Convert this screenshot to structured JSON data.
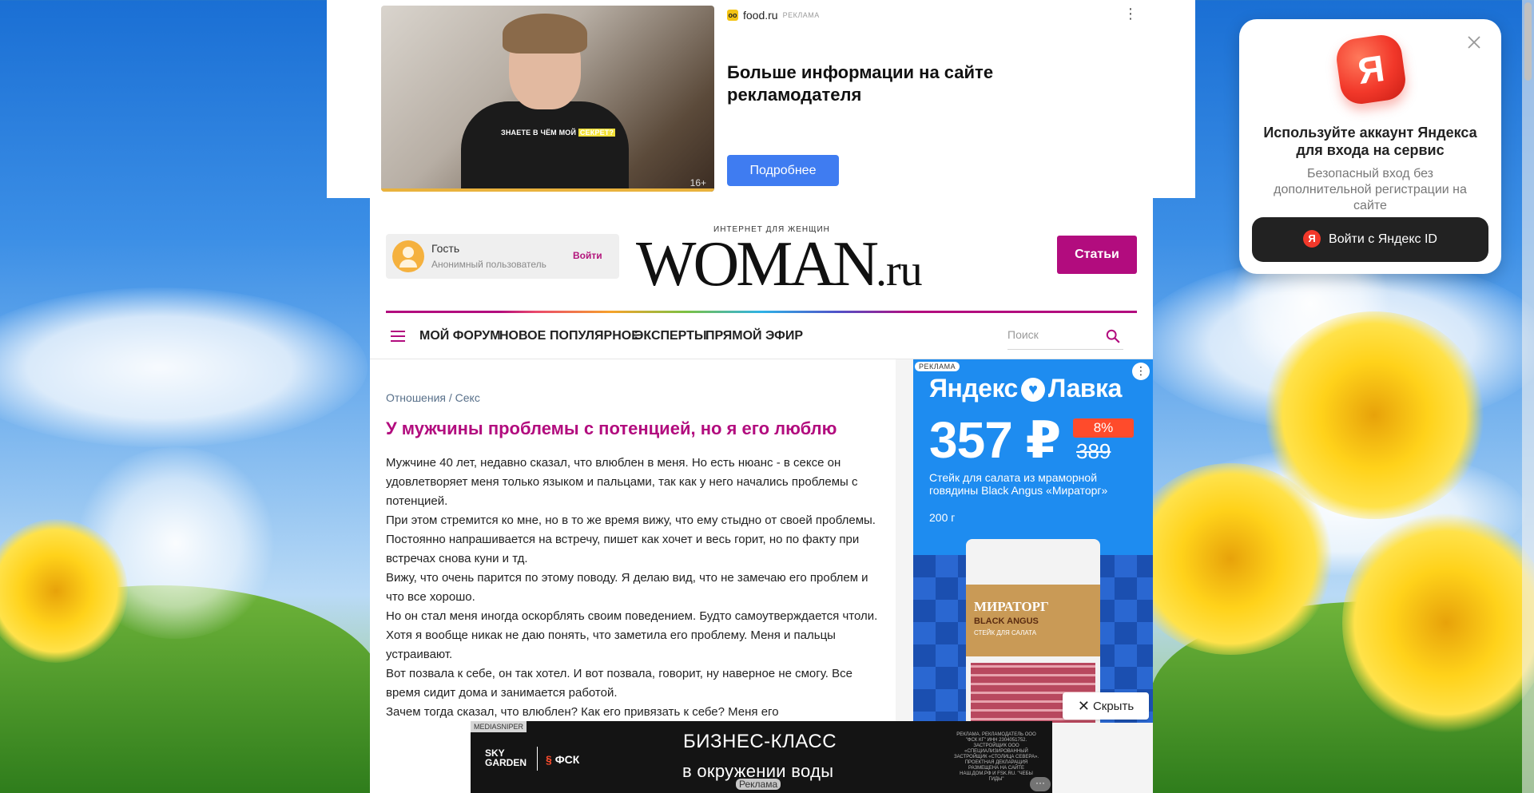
{
  "top_ad": {
    "brand": "food.ru",
    "ad_tag": "РЕКЛАМА",
    "headline": "Больше информации на сайте рекламодателя",
    "cta": "Подробнее",
    "video_subtitle_a": "ЗНАЕТЕ В ЧЁМ МОЙ",
    "video_subtitle_b": "СЕКРЕТ?",
    "age_rating": "16+",
    "menu_icon": "more-vertical-icon"
  },
  "header": {
    "user_name": "Гость",
    "user_sub": "Анонимный пользователь",
    "login": "Войти",
    "logo_tagline": "ИНТЕРНЕТ ДЛЯ ЖЕНЩИН",
    "logo_main": "WOMAN",
    "logo_suffix": ".ru",
    "articles_button": "Статьи",
    "accent_color": "#b20c7e"
  },
  "nav": {
    "items": [
      "МОЙ ФОРУМ",
      "НОВОЕ",
      "ПОПУЛЯРНОЕ",
      "ЭКСПЕРТЫ",
      "ПРЯМОЙ ЭФИР"
    ],
    "search_placeholder": "Поиск"
  },
  "article": {
    "breadcrumb": [
      "Отношения",
      "Секс"
    ],
    "breadcrumb_sep": "/",
    "title": "У мужчины проблемы с потенцией, но я его люблю",
    "paragraphs": [
      "Мужчине 40 лет, недавно сказал, что влюблен в меня. Но есть нюанс - в сексе он удовлетворяет меня только языком и пальцами, так как у него начались проблемы с потенцией.",
      "При этом стремится ко мне, но в то же время вижу, что ему стыдно от своей проблемы. Постоянно напрашивается на встречу, пишет как хочет и весь горит, но по факту при встречах снова куни и тд.",
      "Вижу, что очень парится по этому поводу. Я делаю вид, что не замечаю его проблем и что все хорошо.",
      "Но он стал меня иногда оскорблять своим поведением. Будто самоутверждается чтоли. Хотя я вообще никак не даю понять, что заметила его проблему. Меня и пальцы устраивают.",
      "Вот позвала к себе, он так хотел. И вот позвала, говорит, ну наверное не смогу. Все время сидит дома и занимается работой.",
      "Зачем тогда сказал, что влюблен? Как его привязать к себе? Меня его"
    ]
  },
  "side_ad": {
    "tag": "РЕКЛАМА",
    "brand_a": "Яндекс",
    "brand_b": "Лавка",
    "price": "357 ₽",
    "discount": "8%",
    "old_price": "389",
    "desc": "Стейк для салата из мраморной говядины Black Angus «Мираторг»",
    "weight": "200 г",
    "pack_brand": "МИРАТОРГ",
    "pack_line": "BLACK ANGUS",
    "pack_sub": "СТЕЙК ДЛЯ САЛАТА",
    "hide": "Скрыть"
  },
  "bottom_ad": {
    "tag": "MEDIASNIPER",
    "brand1_a": "SKY",
    "brand1_b": "GARDEN",
    "brand2": "ФСК",
    "headline1": "БИЗНЕС-КЛАСС",
    "headline2": "в окружении воды",
    "legal": "РЕКЛАМА. РЕКЛАМОДАТЕЛЬ ООО \"ФСК КГ\" ИНН 2304051752. ЗАСТРОЙЩИК ООО «СПЕЦИАЛИЗИРОВАННЫЙ ЗАСТРОЙЩИК «СТОЛИЦА СЕВЕРА». ПРОЕКТНАЯ ДЕКЛАРАЦИЯ РАЗМЕЩЕНА НА САЙТЕ НАШ.ДОМ.РФ И FSK.RU. \"ЧЕБЫ ГИДЫ\"",
    "ad_label": "Реклама",
    "more": "···"
  },
  "ya_popup": {
    "logo_letter": "Я",
    "title": "Используйте аккаунт Яндекса для входа на сервис",
    "subtitle": "Безопасный вход без дополнительной регистрации на сайте",
    "button": "Войти с Яндекс ID",
    "button_icon_letter": "Я"
  }
}
